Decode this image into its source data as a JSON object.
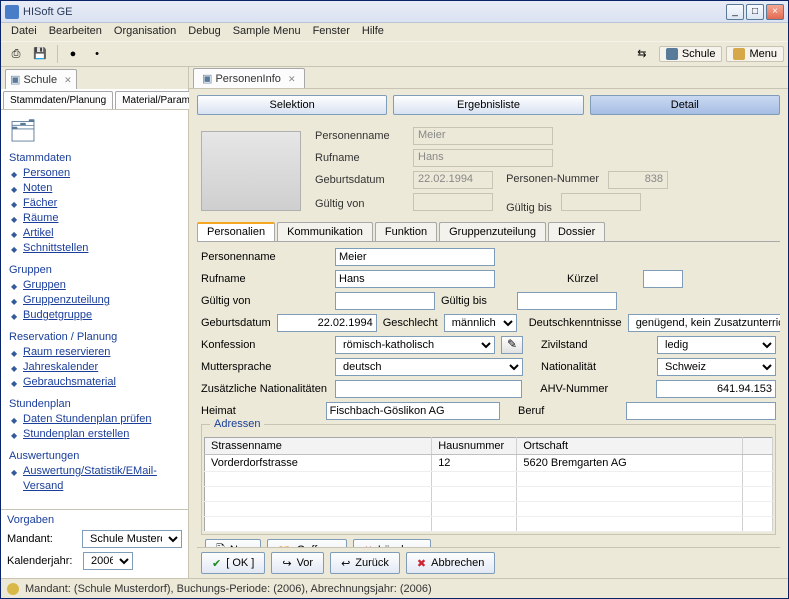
{
  "window": {
    "title": "HISoft GE"
  },
  "menu": [
    "Datei",
    "Bearbeiten",
    "Organisation",
    "Debug",
    "Sample Menu",
    "Fenster",
    "Hilfe"
  ],
  "toolbar_right": {
    "tab_chip": "Schule",
    "menu_chip": "Menu"
  },
  "left_tab": "Schule",
  "left_subtabs": [
    "Stammdaten/Planung",
    "Material/Parameter"
  ],
  "nav": {
    "groups": [
      {
        "title": "Stammdaten",
        "items": [
          "Personen",
          "Noten",
          "Fächer",
          "Räume",
          "Artikel",
          "Schnittstellen"
        ]
      },
      {
        "title": "Gruppen",
        "items": [
          "Gruppen",
          "Gruppenzuteilung",
          "Budgetgruppe"
        ]
      },
      {
        "title": "Reservation / Planung",
        "items": [
          "Raum reservieren",
          "Jahreskalender",
          "Gebrauchsmaterial"
        ]
      },
      {
        "title": "Stundenplan",
        "items": [
          "Daten Stundenplan prüfen",
          "Stundenplan erstellen"
        ]
      },
      {
        "title": "Auswertungen",
        "items": [
          "Auswertung/Statistik/EMail-Versand"
        ]
      }
    ]
  },
  "vorgaben": {
    "header": "Vorgaben",
    "mandant_label": "Mandant:",
    "mandant_value": "Schule Musterdorf",
    "kalenderjahr_label": "Kalenderjahr:",
    "kalenderjahr_value": "2006"
  },
  "right_tab": "PersonenInfo",
  "segments": {
    "selektion": "Selektion",
    "ergebnisliste": "Ergebnisliste",
    "detail": "Detail"
  },
  "head": {
    "personenname_lbl": "Personenname",
    "personenname": "Meier",
    "rufname_lbl": "Rufname",
    "rufname": "Hans",
    "geburtsdatum_lbl": "Geburtsdatum",
    "geburtsdatum": "22.02.1994",
    "personennr_lbl": "Personen-Nummer",
    "personennr": "838",
    "gueltig_von_lbl": "Gültig von",
    "gueltig_von": "",
    "gueltig_bis_lbl": "Gültig bis",
    "gueltig_bis": ""
  },
  "ptabs": [
    "Personalien",
    "Kommunikation",
    "Funktion",
    "Gruppenzuteilung",
    "Dossier"
  ],
  "form": {
    "personenname_lbl": "Personenname",
    "personenname": "Meier",
    "rufname_lbl": "Rufname",
    "rufname": "Hans",
    "kuerzel_lbl": "Kürzel",
    "kuerzel": "",
    "gueltig_von_lbl": "Gültig von",
    "gueltig_von": "",
    "gueltig_bis_lbl": "Gültig bis",
    "gueltig_bis": "",
    "geburtsdatum_lbl": "Geburtsdatum",
    "geburtsdatum": "22.02.1994",
    "geschlecht_lbl": "Geschlecht",
    "geschlecht": "männlich",
    "deutschk_lbl": "Deutschkenntnisse",
    "deutschk": "genügend, kein Zusatzunterricht",
    "konfession_lbl": "Konfession",
    "konfession": "römisch-katholisch",
    "zivilstand_lbl": "Zivilstand",
    "zivilstand": "ledig",
    "muttersprache_lbl": "Muttersprache",
    "muttersprache": "deutsch",
    "nationalitaet_lbl": "Nationalität",
    "nationalitaet": "Schweiz",
    "zusnat_lbl": "Zusätzliche Nationalitäten",
    "zusnat": "",
    "ahv_lbl": "AHV-Nummer",
    "ahv": "641.94.153",
    "heimat_lbl": "Heimat",
    "heimat": "Fischbach-Göslikon AG",
    "beruf_lbl": "Beruf",
    "beruf": ""
  },
  "adressen": {
    "legend": "Adressen",
    "cols": [
      "Strassenname",
      "Hausnummer",
      "Ortschaft"
    ],
    "rows": [
      {
        "strasse": "Vorderdorfstrasse",
        "hausnr": "12",
        "ort": "5620 Bremgarten AG"
      }
    ]
  },
  "rowbuttons": {
    "neu": "Neu",
    "oeffnen": "Oeffnen",
    "loeschen": "Löschen"
  },
  "bottombuttons": {
    "ok": "[ OK ]",
    "vor": "Vor",
    "zurueck": "Zurück",
    "abbrechen": "Abbrechen"
  },
  "status": "Mandant: (Schule Musterdorf), Buchungs-Periode: (2006), Abrechnungsjahr: (2006)"
}
